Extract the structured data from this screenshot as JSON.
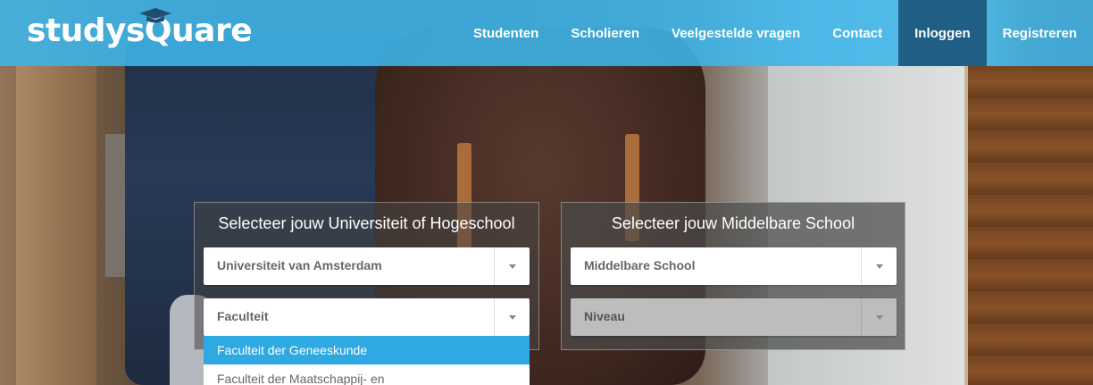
{
  "brand": {
    "logo_text": "studysQuare"
  },
  "nav": {
    "items": [
      {
        "label": "Studenten"
      },
      {
        "label": "Scholieren"
      },
      {
        "label": "Veelgestelde vragen"
      },
      {
        "label": "Contact"
      },
      {
        "label": "Inloggen"
      },
      {
        "label": "Registreren"
      }
    ]
  },
  "university_panel": {
    "title": "Selecteer jouw Universiteit of Hogeschool",
    "institution_select": "Universiteit van Amsterdam",
    "faculty_select": "Faculteit",
    "faculty_options": [
      "Faculteit der Geneeskunde",
      "Faculteit der Maatschappij- en"
    ]
  },
  "school_panel": {
    "title": "Selecteer jouw Middelbare School",
    "school_select": "Middelbare School",
    "level_select": "Niveau"
  },
  "colors": {
    "nav_bg": "#3db6ec",
    "nav_active": "#1f5f86",
    "option_highlight": "#2ea9e1"
  }
}
